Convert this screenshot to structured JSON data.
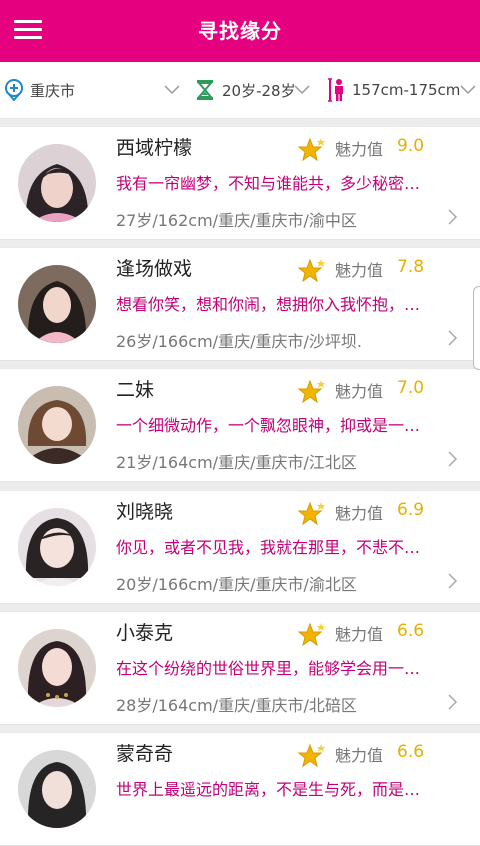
{
  "header": {
    "title": "寻找缘分",
    "menu_icon": "hamburger-menu-icon"
  },
  "filters": {
    "city": {
      "label": "重庆市",
      "icon": "location-pin-icon"
    },
    "age": {
      "label": "20岁-28岁",
      "icon": "hourglass-icon"
    },
    "height": {
      "label": "157cm-175cm",
      "icon": "height-person-icon"
    }
  },
  "colors": {
    "brand": "#e4007f",
    "motto": "#c2007a",
    "charm_value": "#e5b000",
    "filter_icon_blue": "#1e88c9",
    "filter_icon_green": "#2e9b5b",
    "filter_icon_pink": "#e4007f"
  },
  "charm_label": "魅力值",
  "users": [
    {
      "name": "西域柠檬",
      "charm": "9.0",
      "motto": "我有一帘幽梦，不知与谁能共，多少秘密…",
      "info": "27岁/162cm/重庆/重庆市/渝中区"
    },
    {
      "name": "逢场做戏",
      "charm": "7.8",
      "motto": "想看你笑，想和你闹，想拥你入我怀抱，…",
      "info": "26岁/166cm/重庆/重庆市/沙坪坝."
    },
    {
      "name": "二妹",
      "charm": "7.0",
      "motto": "一个细微动作，一个飘忽眼神，抑或是一…",
      "info": "21岁/164cm/重庆/重庆市/江北区"
    },
    {
      "name": "刘晓晓",
      "charm": "6.9",
      "motto": "你见，或者不见我，我就在那里，不悲不…",
      "info": "20岁/166cm/重庆/重庆市/渝北区"
    },
    {
      "name": "小泰克",
      "charm": "6.6",
      "motto": "在这个纷绕的世俗世界里，能够学会用一…",
      "info": "28岁/164cm/重庆/重庆市/北碚区"
    },
    {
      "name": "蒙奇奇",
      "charm": "6.6",
      "motto": "世界上最遥远的距离，不是生与死，而是…",
      "info": ""
    }
  ]
}
